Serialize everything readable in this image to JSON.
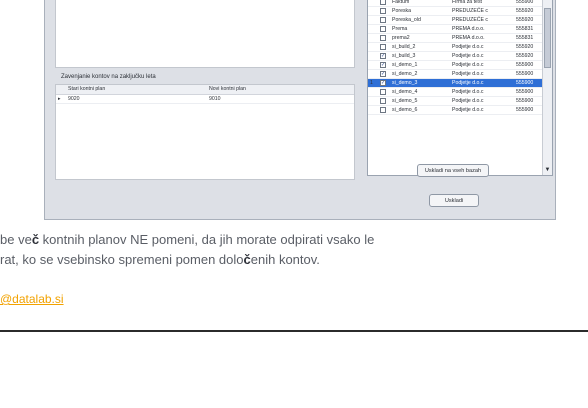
{
  "window": {
    "section_title": "Zavenjanie kontov na zaključku leta",
    "mapping_table": {
      "headers": [
        "Stari kontni plan",
        "Novi kontni plan"
      ],
      "rows": [
        {
          "marker": "▸",
          "old": "9020",
          "new": "9010"
        }
      ]
    },
    "db_list": {
      "rows": [
        {
          "checked": false,
          "name": "Faktum",
          "firm": "Firma za test",
          "code": "555900",
          "selected": false
        },
        {
          "checked": false,
          "name": "Poreska",
          "firm": "PREDUZEĆE c",
          "code": "555920",
          "selected": false
        },
        {
          "checked": false,
          "name": "Poreska_old",
          "firm": "PREDUZEĆE c",
          "code": "555920",
          "selected": false
        },
        {
          "checked": false,
          "name": "Prema",
          "firm": "PREMA d.o.o.",
          "code": "555831",
          "selected": false
        },
        {
          "checked": false,
          "name": "prema2",
          "firm": "PREMA d.o.o.",
          "code": "555831",
          "selected": false
        },
        {
          "checked": false,
          "name": "si_build_2",
          "firm": "Podjetje d.o.c",
          "code": "555920",
          "selected": false
        },
        {
          "checked": true,
          "name": "si_build_3",
          "firm": "Podjetje d.o.c",
          "code": "555920",
          "selected": false
        },
        {
          "checked": true,
          "name": "si_demo_1",
          "firm": "Podjetje d.o.c",
          "code": "555900",
          "selected": false
        },
        {
          "checked": true,
          "name": "si_demo_2",
          "firm": "Podjetje d.o.c",
          "code": "555900",
          "selected": false
        },
        {
          "checked": true,
          "name": "si_demo_3",
          "firm": "Podjetje d.o.c",
          "code": "555900",
          "selected": true
        },
        {
          "checked": false,
          "name": "si_demo_4",
          "firm": "Podjetje d.o.c",
          "code": "555900",
          "selected": false
        },
        {
          "checked": false,
          "name": "si_demo_5",
          "firm": "Podjetje d.o.c",
          "code": "555900",
          "selected": false
        },
        {
          "checked": false,
          "name": "si_demo_6",
          "firm": "Podjetje d.o.c",
          "code": "555900",
          "selected": false
        }
      ],
      "row_marker": "1"
    },
    "buttons": {
      "save_all": "Uskladi na vseh bazah",
      "save": "Uskladi"
    },
    "icons": {
      "scroll_up": "scroll-up-icon",
      "scroll_down": "scroll-down-icon"
    },
    "colors": {
      "selection": "#2f6fd6"
    }
  },
  "page": {
    "paragraph_line1_prefix": "be ve",
    "paragraph_line1_bold": "č",
    "paragraph_line1_suffix": " kontnih planov NE pomeni, da jih morate odpirati vsako le",
    "paragraph_line2_prefix": "rat, ko se vsebinsko spremeni pomen dolo",
    "paragraph_line2_bold": "č",
    "paragraph_line2_suffix": "enih kontov.",
    "email": "@datalab.si"
  }
}
